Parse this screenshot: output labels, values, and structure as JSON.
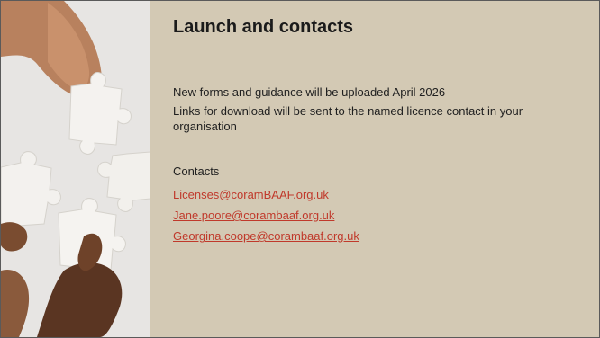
{
  "slide": {
    "title": "Launch and contacts",
    "paragraphs": [
      "New forms and guidance will be uploaded April 2026",
      "Links for download will be sent to the named licence contact in your organisation"
    ],
    "contacts_label": "Contacts",
    "contacts": [
      "Licenses@coramBAAF.org.uk",
      "Jane.poore@corambaaf.org.uk",
      "Georgina.coope@corambaaf.org.uk"
    ]
  },
  "photo": {
    "icon": "hands-holding-puzzle-pieces-photo"
  },
  "colors": {
    "background": "#d3c9b4",
    "link": "#c0392b",
    "text": "#1f1f1f"
  }
}
